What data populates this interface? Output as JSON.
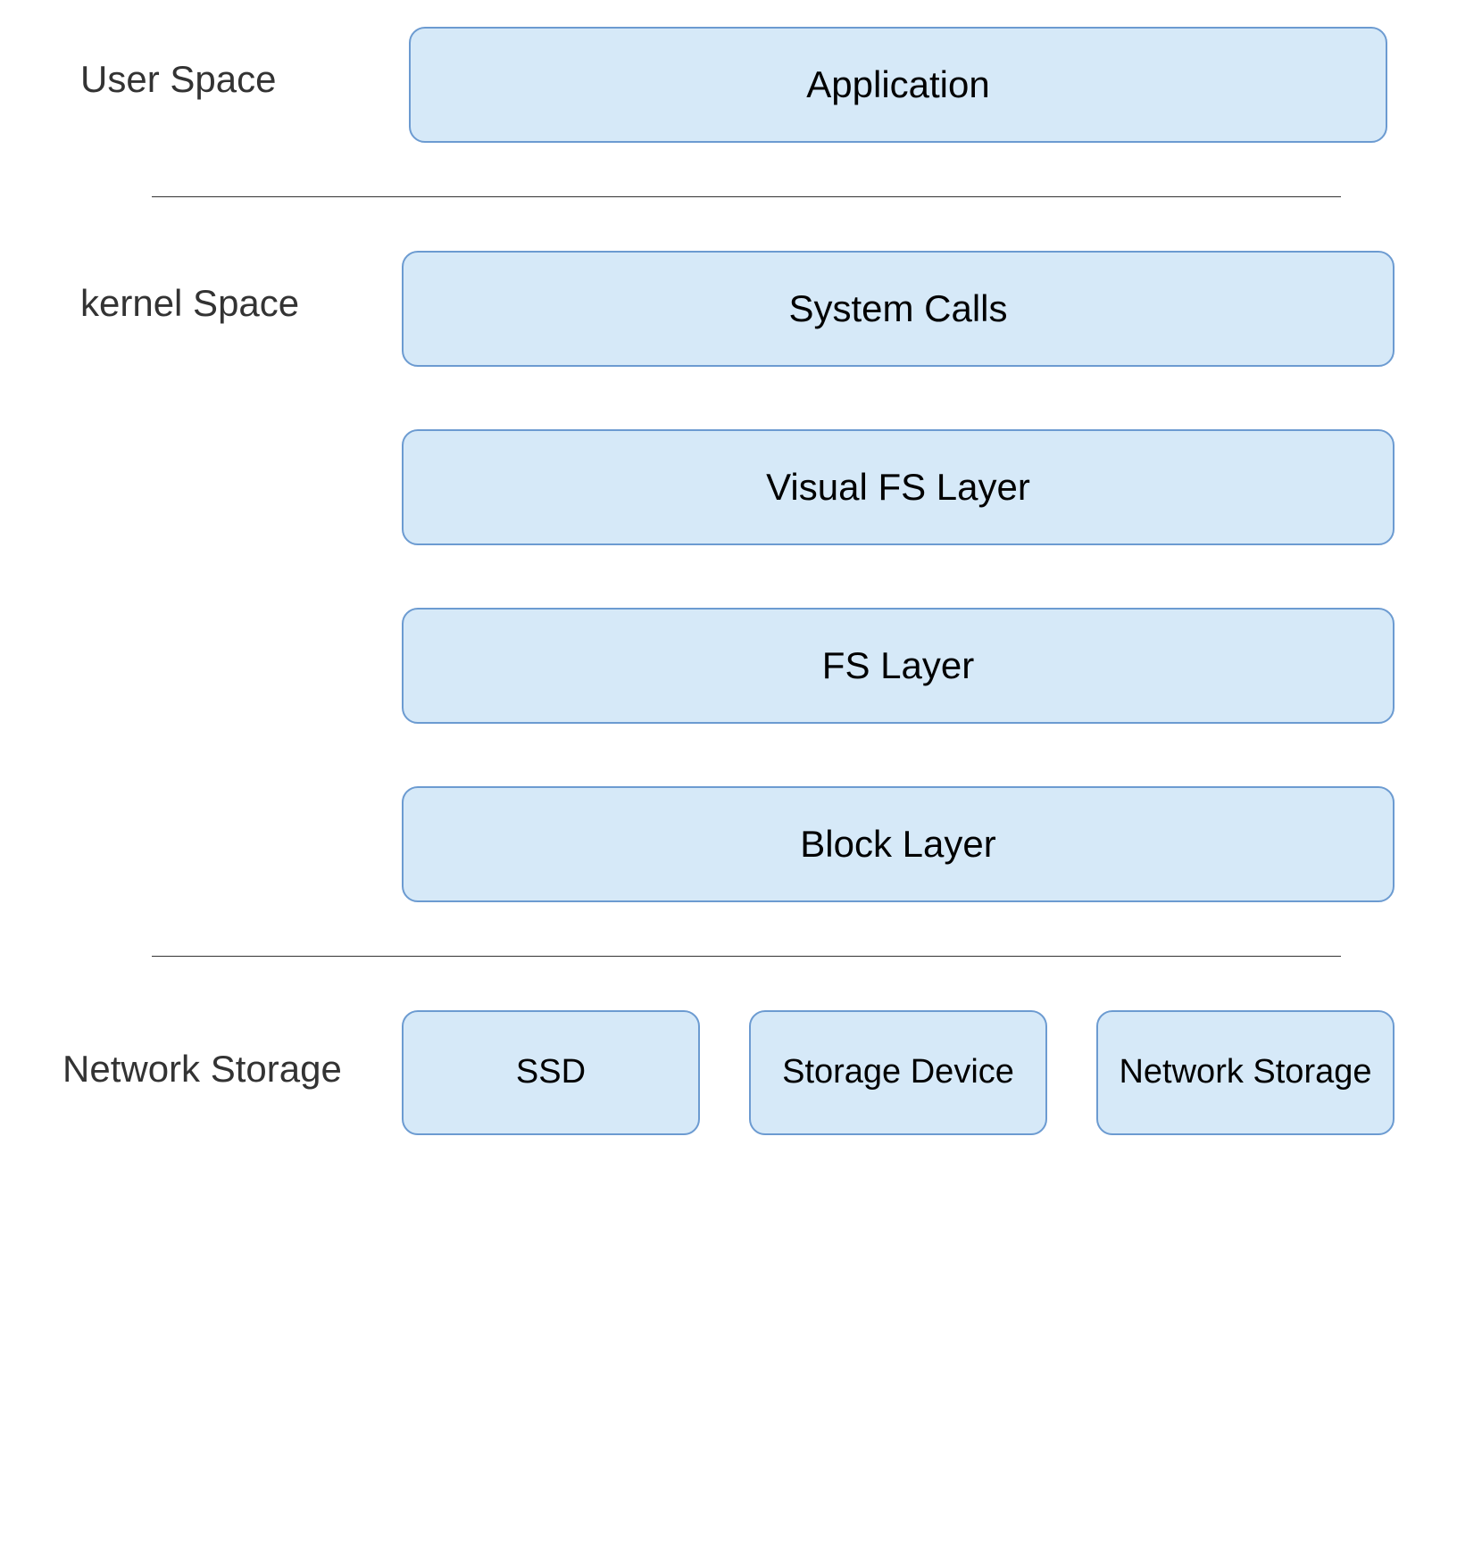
{
  "sections": {
    "userSpace": {
      "label": "User Space",
      "boxes": [
        "Application"
      ]
    },
    "kernelSpace": {
      "label": "kernel Space",
      "boxes": [
        "System Calls",
        "Visual FS Layer",
        "FS Layer",
        "Block Layer"
      ]
    },
    "networkStorage": {
      "label": "Network Storage",
      "boxes": [
        "SSD",
        "Storage Device",
        "Network Storage"
      ]
    }
  }
}
